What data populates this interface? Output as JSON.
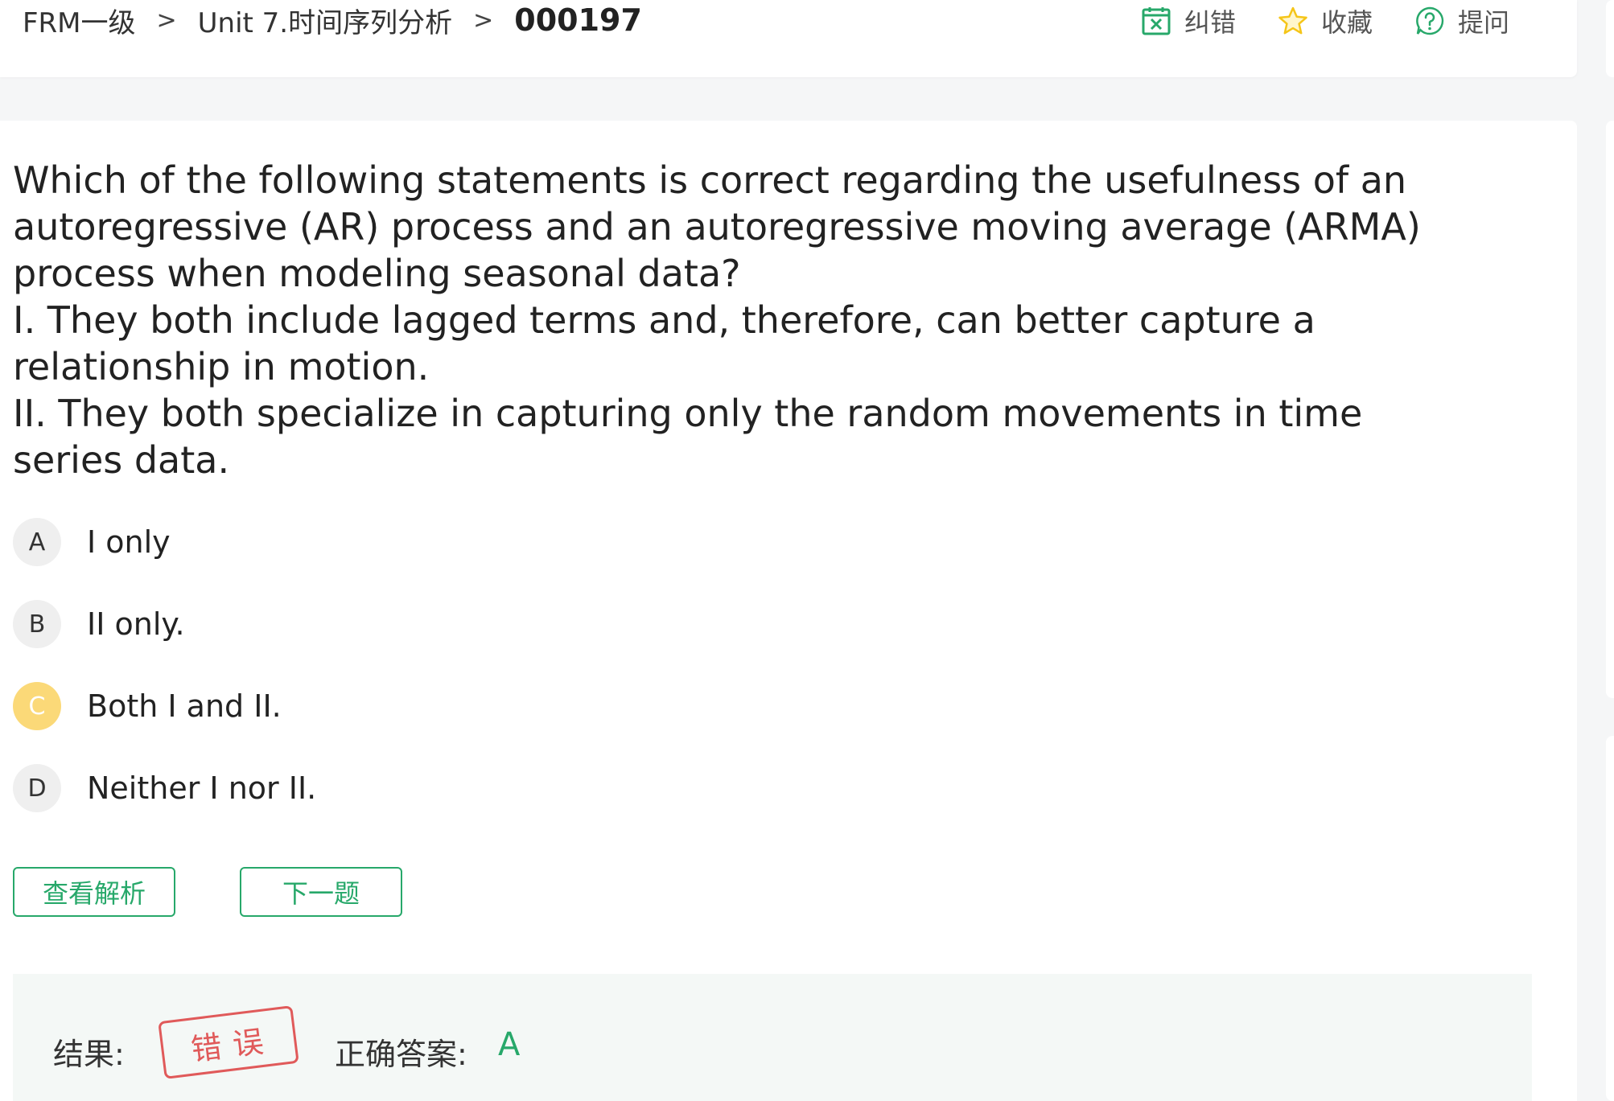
{
  "breadcrumb": {
    "level1": "FRM一级",
    "level2": "Unit 7.时间序列分析",
    "current": "000197",
    "separator": ">"
  },
  "actions": {
    "report_error": {
      "label": "纠错",
      "icon": "report-error-icon",
      "color": "#27a86a"
    },
    "favorite": {
      "label": "收藏",
      "icon": "star-icon",
      "color": "#f5c518"
    },
    "ask": {
      "label": "提问",
      "icon": "question-icon",
      "color": "#27a86a"
    }
  },
  "question": {
    "stem": "Which of the following statements is correct regarding the usefulness of an autoregressive (AR) process and an autoregressive moving average (ARMA) process when modeling seasonal data?",
    "statement_1": "I. They both include lagged terms and, therefore, can better capture a relationship in motion.",
    "statement_2": "II. They both specialize in capturing only the random movements in time series data."
  },
  "options": [
    {
      "letter": "A",
      "text": "I only",
      "selected": false
    },
    {
      "letter": "B",
      "text": "II only.",
      "selected": false
    },
    {
      "letter": "C",
      "text": "Both I and II.",
      "selected": true
    },
    {
      "letter": "D",
      "text": "Neither I nor II.",
      "selected": false
    }
  ],
  "buttons": {
    "view_analysis": "查看解析",
    "next_question": "下一题"
  },
  "result": {
    "label": "结果:",
    "stamp": "错误",
    "correct_answer_label": "正确答案:",
    "correct_answer": "A"
  },
  "colors": {
    "accent_green": "#27a86a",
    "selected_option": "#fbd978",
    "wrong_stamp": "#e05a5a",
    "result_background": "#f4f8f6"
  }
}
